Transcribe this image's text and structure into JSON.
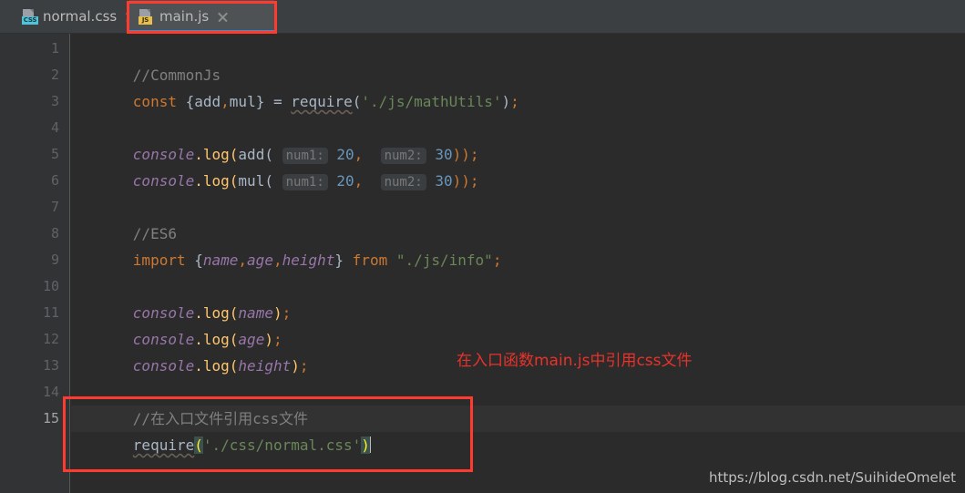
{
  "theme": {
    "tabbar_bg": "#3c3f41",
    "tab_active_bg": "#4e5254",
    "tab_underline": "#4a88c7",
    "editor_bg": "#2b2b2b",
    "gutter_bg": "#313335",
    "current_line_bg": "#323232",
    "annotation_red": "#e8322a",
    "highlight_box_red": "#ff3b30",
    "comment": "#808080",
    "keyword": "#cc7832",
    "function": "#ffc66d",
    "string": "#6a8759",
    "number": "#6897bb",
    "identifier": "#a9b7c6",
    "italic_variable": "#9876aa"
  },
  "tabs": [
    {
      "label": "normal.css",
      "icon": "css-file-icon",
      "badge": "CSS",
      "active": false,
      "close_icon": "close-icon"
    },
    {
      "label": "main.js",
      "icon": "js-file-icon",
      "badge": "JS",
      "active": true,
      "close_icon": "close-icon"
    }
  ],
  "gutter": {
    "line_numbers": [
      "1",
      "2",
      "3",
      "4",
      "5",
      "6",
      "7",
      "8",
      "9",
      "10",
      "11",
      "12",
      "13",
      "14",
      "15"
    ],
    "current_line": "15"
  },
  "code": {
    "line1": {
      "comment": "//CommonJs"
    },
    "line2": {
      "keyword": "const",
      "open_brace": "{",
      "name_add": "add",
      "comma": ",",
      "name_mul": "mul",
      "close_brace": "}",
      "equals": "=",
      "require": "require",
      "paren_open": "(",
      "string": "'./js/mathUtils'",
      "paren_close": ")",
      "semicolon": ";"
    },
    "line4": {
      "object": "console",
      "dot": ".",
      "method": "log",
      "paren_open": "(",
      "fn": "add",
      "fn_paren": "(",
      "hint1": "num1:",
      "arg1": "20",
      "comma": ",",
      "hint2": "num2:",
      "arg2": "30",
      "close": "));",
      "semicolon": ";"
    },
    "line5": {
      "object": "console",
      "dot": ".",
      "method": "log",
      "paren_open": "(",
      "fn": "mul",
      "fn_paren": "(",
      "hint1": "num1:",
      "arg1": "20",
      "comma": ",",
      "hint2": "num2:",
      "arg2": "30",
      "close": "));",
      "semicolon": ";"
    },
    "line7": {
      "comment": "//ES6"
    },
    "line8": {
      "keyword_import": "import",
      "open_brace": "{",
      "name1": "name",
      "comma1": ",",
      "name2": "age",
      "comma2": ",",
      "name3": "height",
      "close_brace": "}",
      "keyword_from": "from",
      "string": "\"./js/info\"",
      "semicolon": ";"
    },
    "line10": {
      "object": "console",
      "dot": ".",
      "method": "log",
      "paren_open": "(",
      "arg": "name",
      "paren_close": ")",
      "semicolon": ";"
    },
    "line11": {
      "object": "console",
      "dot": ".",
      "method": "log",
      "paren_open": "(",
      "arg": "age",
      "paren_close": ")",
      "semicolon": ";"
    },
    "line12": {
      "object": "console",
      "dot": ".",
      "method": "log",
      "paren_open": "(",
      "arg": "height",
      "paren_close": ")",
      "semicolon": ";"
    },
    "line14": {
      "comment": "//在入口文件引用css文件"
    },
    "line15": {
      "require": "require",
      "paren_open": "(",
      "string": "'./css/normal.css'",
      "paren_close": ")"
    }
  },
  "annotation": {
    "text": "在入口函数main.js中引用css文件"
  },
  "watermark": {
    "text": "https://blog.csdn.net/SuihideOmelet"
  }
}
